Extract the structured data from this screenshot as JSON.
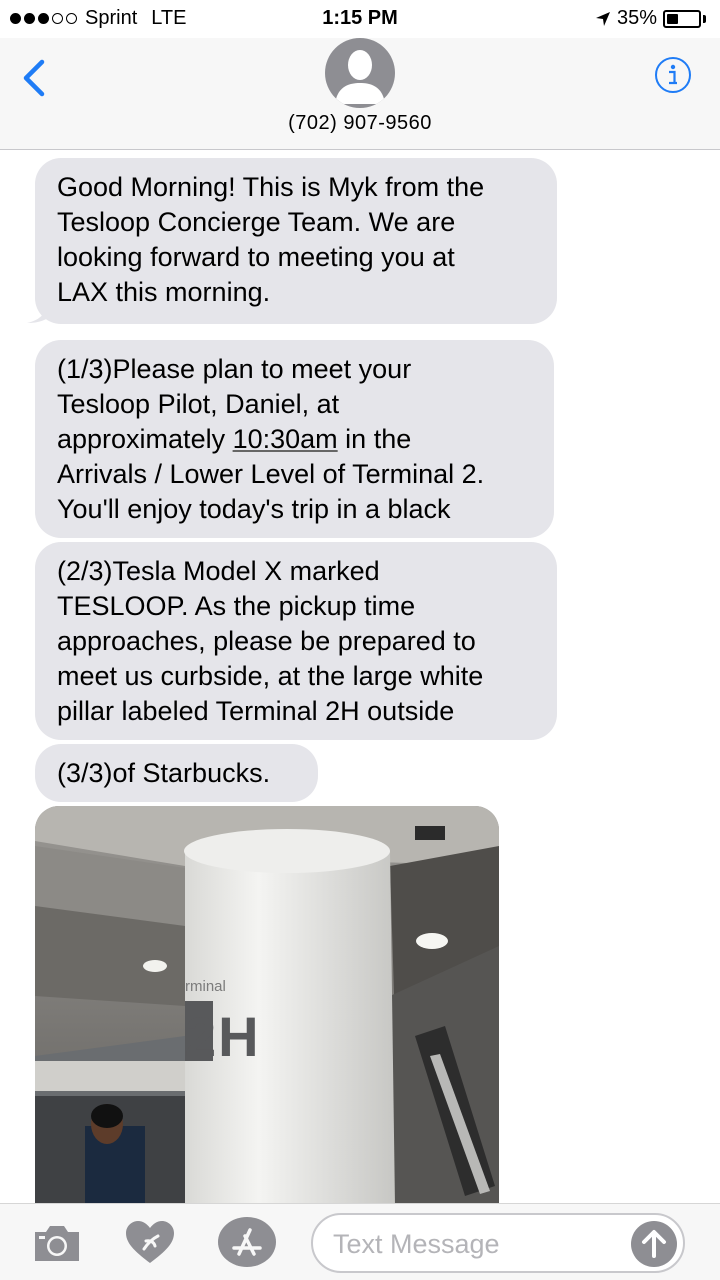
{
  "status_bar": {
    "carrier": "Sprint",
    "network": "LTE",
    "time": "1:15 PM",
    "battery": "35%",
    "battery_level": 0.35,
    "signal_bars_filled": 3,
    "signal_bars_total": 5
  },
  "header": {
    "contact": "(702) 907-9560",
    "back_icon": "chevron-left-icon",
    "info_icon": "info-icon"
  },
  "messages": [
    {
      "lines": [
        "Good Morning! This is Myk from the",
        "Tesloop Concierge Team. We are",
        "looking forward to meeting you at",
        "LAX this morning."
      ]
    },
    {
      "lines": [
        "(1/3)Please plan to meet your",
        "Tesloop Pilot, Daniel, at",
        "approximately ",
        "10:30am",
        " in the",
        "Arrivals / Lower Level of Terminal 2.",
        "You'll enjoy today's trip in a black"
      ]
    },
    {
      "lines": [
        "(2/3)Tesla Model X marked",
        "TESLOOP. As the pickup time",
        "approaches, please be prepared to",
        "meet us curbside, at the large white",
        "pillar labeled Terminal 2H outside"
      ]
    },
    {
      "lines": [
        "(3/3)of Starbucks."
      ]
    }
  ],
  "photo": {
    "pillar_label": "2H",
    "pillar_small_label": "rminal"
  },
  "input_bar": {
    "placeholder": "Text Message",
    "icons": [
      "camera-icon",
      "digital-touch-icon",
      "app-store-icon",
      "send-arrow-icon"
    ]
  },
  "colors": {
    "accent": "#1f7cf6",
    "bubble": "#e5e5ea",
    "header_bg": "#f7f7f7"
  }
}
